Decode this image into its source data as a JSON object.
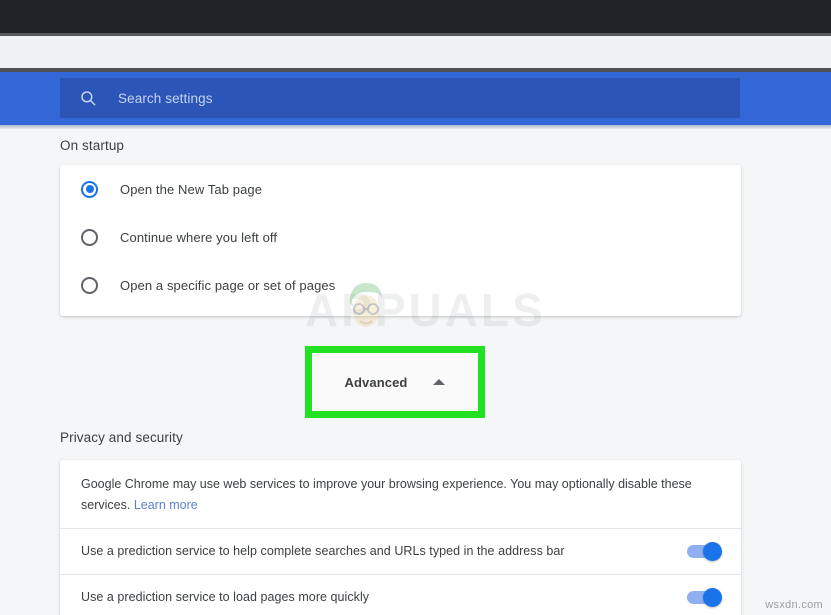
{
  "browser": {
    "titlebar_color": "#202124",
    "toolbar_color": "#f0f1f3"
  },
  "header": {
    "band_color": "#3367d6",
    "search": {
      "icon": "search-icon",
      "placeholder": "Search settings",
      "value": ""
    }
  },
  "sections": {
    "startup": {
      "title": "On startup",
      "options": [
        {
          "label": "Open the New Tab page",
          "selected": true
        },
        {
          "label": "Continue where you left off",
          "selected": false
        },
        {
          "label": "Open a specific page or set of pages",
          "selected": false
        }
      ]
    },
    "advanced": {
      "label": "Advanced",
      "icon": "chevron-up-icon",
      "expanded": true,
      "highlight_color": "#22e022"
    },
    "privacy": {
      "title": "Privacy and security",
      "description": "Google Chrome may use web services to improve your browsing experience. You may optionally disable these services.",
      "learn_more_label": "Learn more",
      "toggles": [
        {
          "label": "Use a prediction service to help complete searches and URLs typed in the address bar",
          "on": true
        },
        {
          "label": "Use a prediction service to load pages more quickly",
          "on": true
        }
      ]
    }
  },
  "watermarks": {
    "brand": "APPUALS",
    "site": "wsxdn.com"
  },
  "colors": {
    "accent": "#1a73e8",
    "header_blue": "#3367d6",
    "search_field": "#2b56b8",
    "link": "#5b7fd4",
    "text": "#3c4043",
    "highlight_green": "#22e022"
  }
}
